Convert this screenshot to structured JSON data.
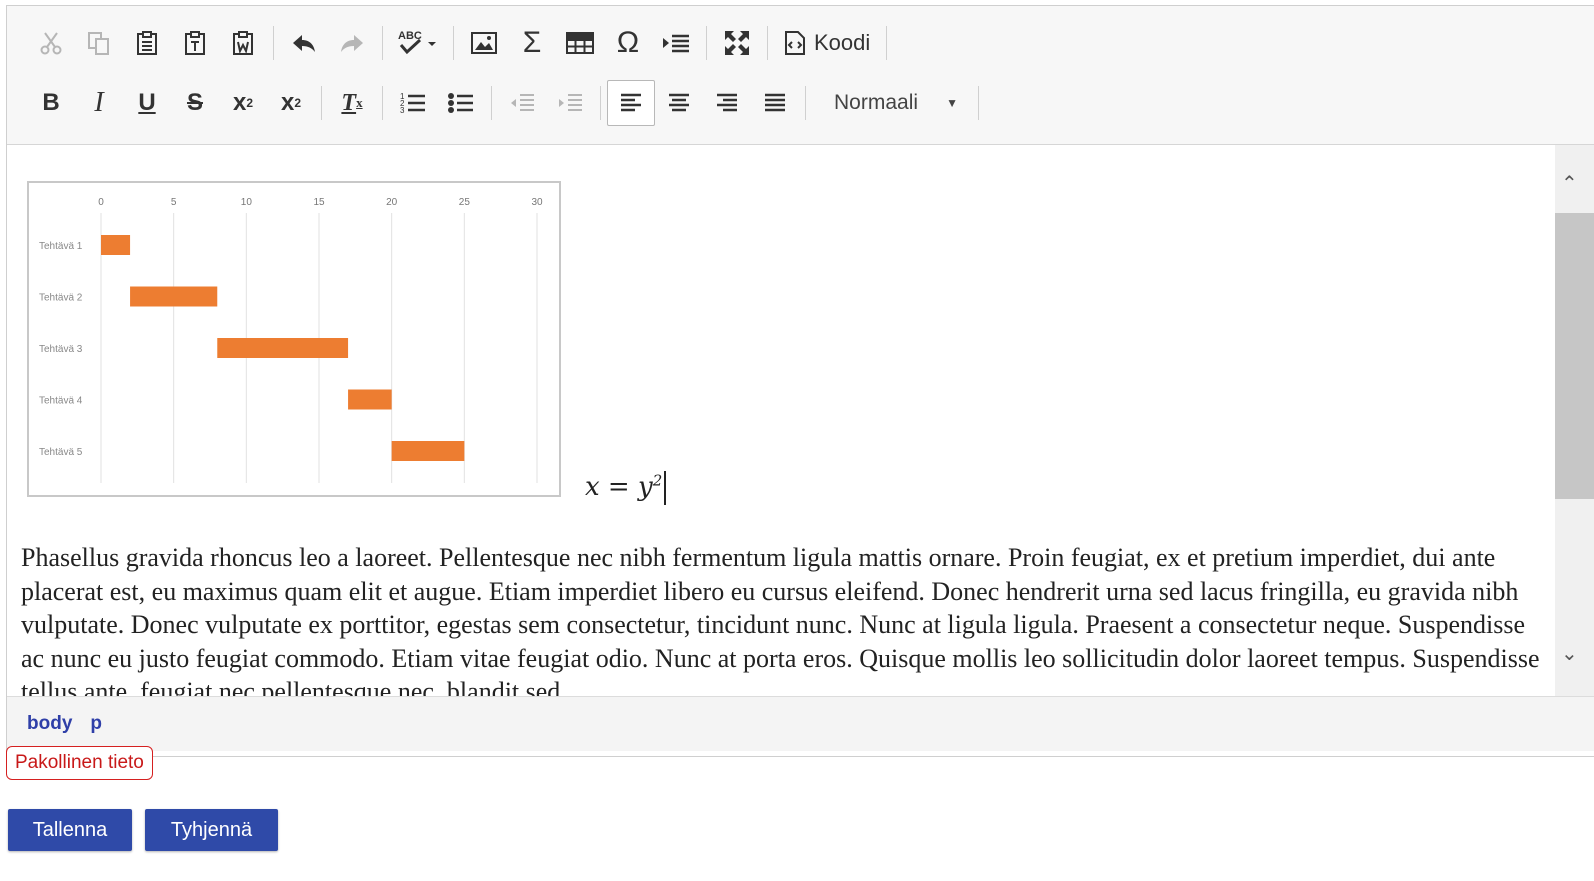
{
  "toolbar": {
    "code_label": "Koodi",
    "format_value": "Normaali"
  },
  "chart_data": {
    "type": "bar",
    "subtype": "gantt",
    "categories": [
      "Tehtävä 1",
      "Tehtävä 2",
      "Tehtävä 3",
      "Tehtävä 4",
      "Tehtävä 5"
    ],
    "start": [
      0,
      2,
      8,
      17,
      20
    ],
    "duration": [
      2,
      6,
      9,
      3,
      5
    ],
    "xticks": [
      "0",
      "5",
      "10",
      "15",
      "20",
      "25",
      "30"
    ],
    "xlim": [
      0,
      30
    ],
    "grid": true,
    "bar_color": "#ed7d31"
  },
  "content": {
    "math_lhs": "x",
    "math_eq": " = ",
    "math_base": "y",
    "math_exp": "2",
    "paragraph": "Phasellus gravida rhoncus leo a laoreet. Pellentesque nec nibh fermentum ligula mattis ornare. Proin feugiat, ex et pretium imperdiet, dui ante placerat est, eu maximus quam elit et augue. Etiam imperdiet libero eu cursus eleifend. Donec hendrerit urna sed lacus fringilla, eu gravida nibh vulputate. Donec vulputate ex porttitor, egestas sem consectetur, tincidunt nunc. Nunc at ligula ligula. Praesent a consectetur neque. Suspendisse ac nunc eu justo feugiat commodo. Etiam vitae feugiat odio. Nunc at porta eros. Quisque mollis leo sollicitudin dolor laoreet tempus. Suspendisse tellus ante, feugiat nec pellentesque nec, blandit sed"
  },
  "path": [
    "body",
    "p"
  ],
  "validation": {
    "required_label": "Pakollinen tieto",
    "color": "#d52020"
  },
  "actions": {
    "save_label": "Tallenna",
    "clear_label": "Tyhjennä",
    "color": "#2f4aa8"
  }
}
